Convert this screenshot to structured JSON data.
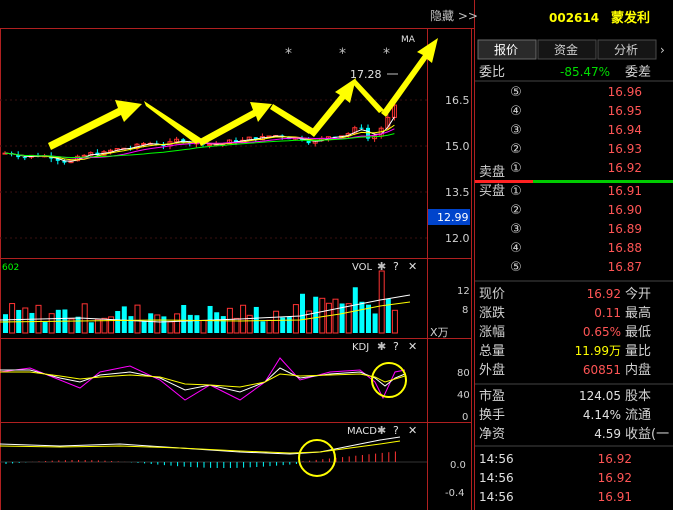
{
  "header": {
    "hide_label": "隐藏 >>"
  },
  "price_panel": {
    "ma_label": "MA",
    "star": "*",
    "high_label": "17.28",
    "current_badge": "12.99",
    "y_ticks": [
      "16.5",
      "15.0",
      "13.5",
      "12.0"
    ]
  },
  "vol_panel": {
    "label": "VOL",
    "left_value": "602",
    "y_ticks": [
      "12",
      "8"
    ],
    "unit": "X万"
  },
  "kdj_panel": {
    "label": "KDJ",
    "y_ticks": [
      "80",
      "40",
      "0"
    ]
  },
  "macd_panel": {
    "label": "MACD",
    "y_ticks": [
      "0.0",
      "-0.4"
    ]
  },
  "panel_icons": {
    "settings": "✱",
    "help": "?",
    "close": "✕"
  },
  "stock": {
    "code": "002614",
    "name": "蒙发利"
  },
  "tabs": [
    {
      "label": "报价"
    },
    {
      "label": "资金"
    },
    {
      "label": "分析"
    }
  ],
  "ratio": {
    "label": "委比",
    "value": "-85.47%",
    "diff_label": "委差"
  },
  "sell_label": "卖盘",
  "buy_label": "买盘",
  "sell_levels": [
    {
      "num": "⑤",
      "price": "16.96"
    },
    {
      "num": "④",
      "price": "16.95"
    },
    {
      "num": "③",
      "price": "16.94"
    },
    {
      "num": "②",
      "price": "16.93"
    },
    {
      "num": "①",
      "price": "16.92"
    }
  ],
  "buy_levels": [
    {
      "num": "①",
      "price": "16.91"
    },
    {
      "num": "②",
      "price": "16.90"
    },
    {
      "num": "③",
      "price": "16.89"
    },
    {
      "num": "④",
      "price": "16.88"
    },
    {
      "num": "⑤",
      "price": "16.87"
    }
  ],
  "quote_rows": [
    {
      "label": "现价",
      "value": "16.92",
      "color": "#ff5555",
      "right": "今开"
    },
    {
      "label": "涨跌",
      "value": "0.11",
      "color": "#ff5555",
      "right": "最高"
    },
    {
      "label": "涨幅",
      "value": "0.65%",
      "color": "#ff5555",
      "right": "最低"
    },
    {
      "label": "总量",
      "value": "11.99万",
      "color": "#ffff00",
      "right": "量比"
    },
    {
      "label": "外盘",
      "value": "60851",
      "color": "#ff5555",
      "right": "内盘"
    }
  ],
  "stats_rows": [
    {
      "label": "市盈",
      "value": "124.05",
      "right": "股本"
    },
    {
      "label": "换手",
      "value": "4.14%",
      "right": "流通"
    },
    {
      "label": "净资",
      "value": "4.59",
      "right": "收益(一"
    }
  ],
  "trades": [
    {
      "time": "14:56",
      "price": "16.92"
    },
    {
      "time": "14:56",
      "price": "16.92"
    },
    {
      "time": "14:56",
      "price": "16.91"
    }
  ],
  "colors": {
    "up": "#ff3333",
    "down": "#00ffff",
    "ma_white": "#ffffff",
    "ma_yellow": "#ffff00",
    "ma_magenta": "#ff00ff",
    "ma_green": "#00ff00",
    "arrow": "#ffff00",
    "accent_blue": "#0044cc"
  }
}
